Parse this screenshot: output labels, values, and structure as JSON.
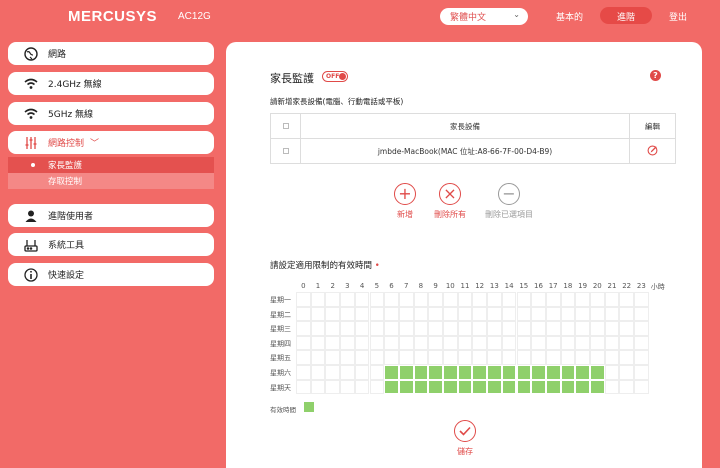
{
  "header": {
    "brand": "MERCUSYS",
    "model": "AC12G",
    "language": "繁體中文",
    "nav": {
      "basic": "基本的",
      "advanced": "進階",
      "logout": "登出"
    }
  },
  "sidebar": {
    "items": [
      {
        "label": "網路",
        "icon": "globe-icon"
      },
      {
        "label": "2.4GHz 無線",
        "icon": "wifi-icon"
      },
      {
        "label": "5GHz 無線",
        "icon": "wifi-icon"
      },
      {
        "label": "網路控制",
        "icon": "sliders-icon",
        "active": true
      },
      {
        "label": "進階使用者",
        "icon": "user-icon"
      },
      {
        "label": "系統工具",
        "icon": "router-icon"
      },
      {
        "label": "快速設定",
        "icon": "info-icon"
      }
    ],
    "submenu": [
      {
        "label": "家長監護",
        "selected": true
      },
      {
        "label": "存取控制",
        "selected": false
      }
    ]
  },
  "main": {
    "title": "家長監護",
    "toggle": "OFF",
    "help": "?",
    "description": "請新增家長設備(電腦、行動電話或平板)",
    "table": {
      "headers": [
        "家長設備",
        "編輯"
      ],
      "rows": [
        {
          "device": "jmbde-MacBook(MAC 位址:A8-66-7F-00-D4-B9)"
        }
      ]
    },
    "actions": {
      "add": "新增",
      "delete_all": "刪除所有",
      "delete_selected": "刪除已選項目"
    },
    "schedule": {
      "title": "請設定適用限制的有效時間",
      "required": "•",
      "hours": [
        "0",
        "1",
        "2",
        "3",
        "4",
        "5",
        "6",
        "7",
        "8",
        "9",
        "10",
        "11",
        "12",
        "13",
        "14",
        "15",
        "16",
        "17",
        "18",
        "19",
        "20",
        "21",
        "22",
        "23"
      ],
      "hour_unit": "小時",
      "days": [
        "星期一",
        "星期二",
        "星期三",
        "星期四",
        "星期五",
        "星期六",
        "星期天"
      ],
      "active": {
        "星期六": [
          6,
          20
        ],
        "星期天": [
          6,
          20
        ]
      }
    },
    "legend": "有效時間",
    "save": "儲存"
  },
  "colors": {
    "accent": "#e04a48",
    "background": "#f26a67",
    "active_cell": "#8fd06b"
  }
}
